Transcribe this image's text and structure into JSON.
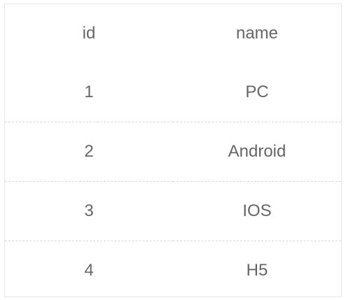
{
  "table": {
    "columns": [
      {
        "key": "id",
        "label": "id"
      },
      {
        "key": "name",
        "label": "name"
      }
    ],
    "rows": [
      {
        "id": "1",
        "name": "PC"
      },
      {
        "id": "2",
        "name": "Android"
      },
      {
        "id": "3",
        "name": "IOS"
      },
      {
        "id": "4",
        "name": "H5"
      }
    ]
  },
  "colors": {
    "text": "#666666",
    "border": "#e6e6e6",
    "row_divider": "#d9d9d9"
  }
}
